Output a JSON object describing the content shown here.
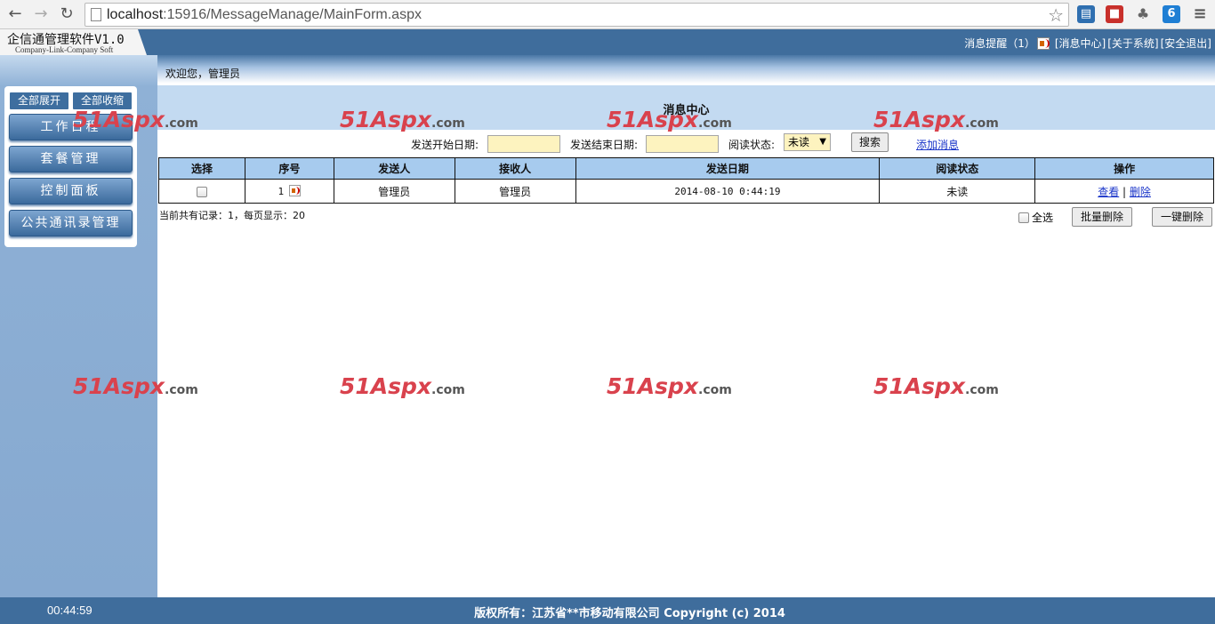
{
  "browser": {
    "url_host": "localhost",
    "url_rest": ":15916/MessageManage/MainForm.aspx"
  },
  "header": {
    "logo_title": "企信通管理软件V1.0",
    "logo_subtitle": "Company-Link-Company Soft",
    "alert_label": "消息提醒（1）",
    "message_center_link": "[消息中心]",
    "about_link": "[关于系统]",
    "logout_link": "[安全退出]"
  },
  "sidebar": {
    "expand_all": "全部展开",
    "collapse_all": "全部收缩",
    "items": [
      {
        "label": "工作日程"
      },
      {
        "label": "套餐管理"
      },
      {
        "label": "控制面板"
      },
      {
        "label": "公共通讯录管理"
      }
    ]
  },
  "welcome": "欢迎您，管理员",
  "main": {
    "title": "消息中心",
    "search": {
      "start_date_label": "发送开始日期:",
      "start_date_value": "",
      "end_date_label": "发送结束日期:",
      "end_date_value": "",
      "status_label": "阅读状态:",
      "status_selected": "未读",
      "search_button": "搜索",
      "add_link": "添加消息"
    },
    "table": {
      "columns": [
        "选择",
        "序号",
        "发送人",
        "接收人",
        "发送日期",
        "阅读状态",
        "操作"
      ],
      "rows": [
        {
          "index": "1",
          "sender": "管理员",
          "receiver": "管理员",
          "date": "2014-08-10 0:44:19",
          "status": "未读",
          "view": "查看",
          "delete": "删除"
        }
      ]
    },
    "records_text": "当前共有记录：1，每页显示：20",
    "select_all_label": "全选",
    "batch_delete_button": "批量删除",
    "one_click_delete_button": "一键删除"
  },
  "watermark": {
    "num": "51",
    "brand": "Aspx",
    "suffix": ".com"
  },
  "footer": {
    "clock": "00:44:59",
    "copyright": "版权所有：江苏省**市移动有限公司 Copyright (c) 2014"
  }
}
